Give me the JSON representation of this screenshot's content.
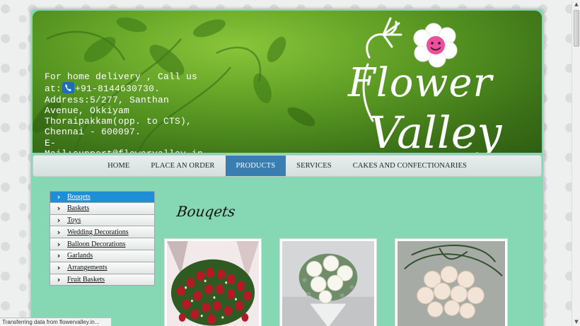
{
  "header": {
    "contact_line1": "For home delivery , Call us",
    "contact_at": "at:",
    "contact_phone": "+91-8144630730.",
    "contact_address": "Address:5/277, Santhan Avenue, Okkiyam Thoraipakkam(opp. to CTS), Chennai - 600097.",
    "contact_email": "E-Mail:support@flowervalley.in.",
    "logo_line1": "Flower",
    "logo_line2": "Valley",
    "phone_icon": "phone-icon",
    "colors": {
      "banner": "#4f8c1f",
      "banner_light": "#8bc53a"
    }
  },
  "nav": {
    "items": [
      {
        "label": "Home",
        "active": false
      },
      {
        "label": "Place an Order",
        "active": false
      },
      {
        "label": "Products",
        "active": true
      },
      {
        "label": "Services",
        "active": false
      },
      {
        "label": "Cakes and Confectionaries",
        "active": false
      }
    ],
    "active_color": "#3a7db0"
  },
  "sidebar": {
    "items": [
      {
        "label": "Bouqets",
        "active": true
      },
      {
        "label": "Baskets",
        "active": false
      },
      {
        "label": "Toys",
        "active": false
      },
      {
        "label": "Wedding Decorations",
        "active": false
      },
      {
        "label": "Balloon Decorations",
        "active": false
      },
      {
        "label": "Garlands",
        "active": false
      },
      {
        "label": "Arrangements",
        "active": false
      },
      {
        "label": "Fruit Baskets",
        "active": false
      }
    ],
    "chevron_icon": "chevron-right-icon",
    "active_color": "#1e8fd6"
  },
  "main": {
    "section_title": "Bouqets",
    "products": [
      {
        "name": "red-roses-bouquet"
      },
      {
        "name": "white-roses-bouquet"
      },
      {
        "name": "peach-roses-bouquet"
      }
    ],
    "background": "#86d7b4"
  },
  "status": {
    "text": "Transferring data from flowervalley.in..."
  }
}
